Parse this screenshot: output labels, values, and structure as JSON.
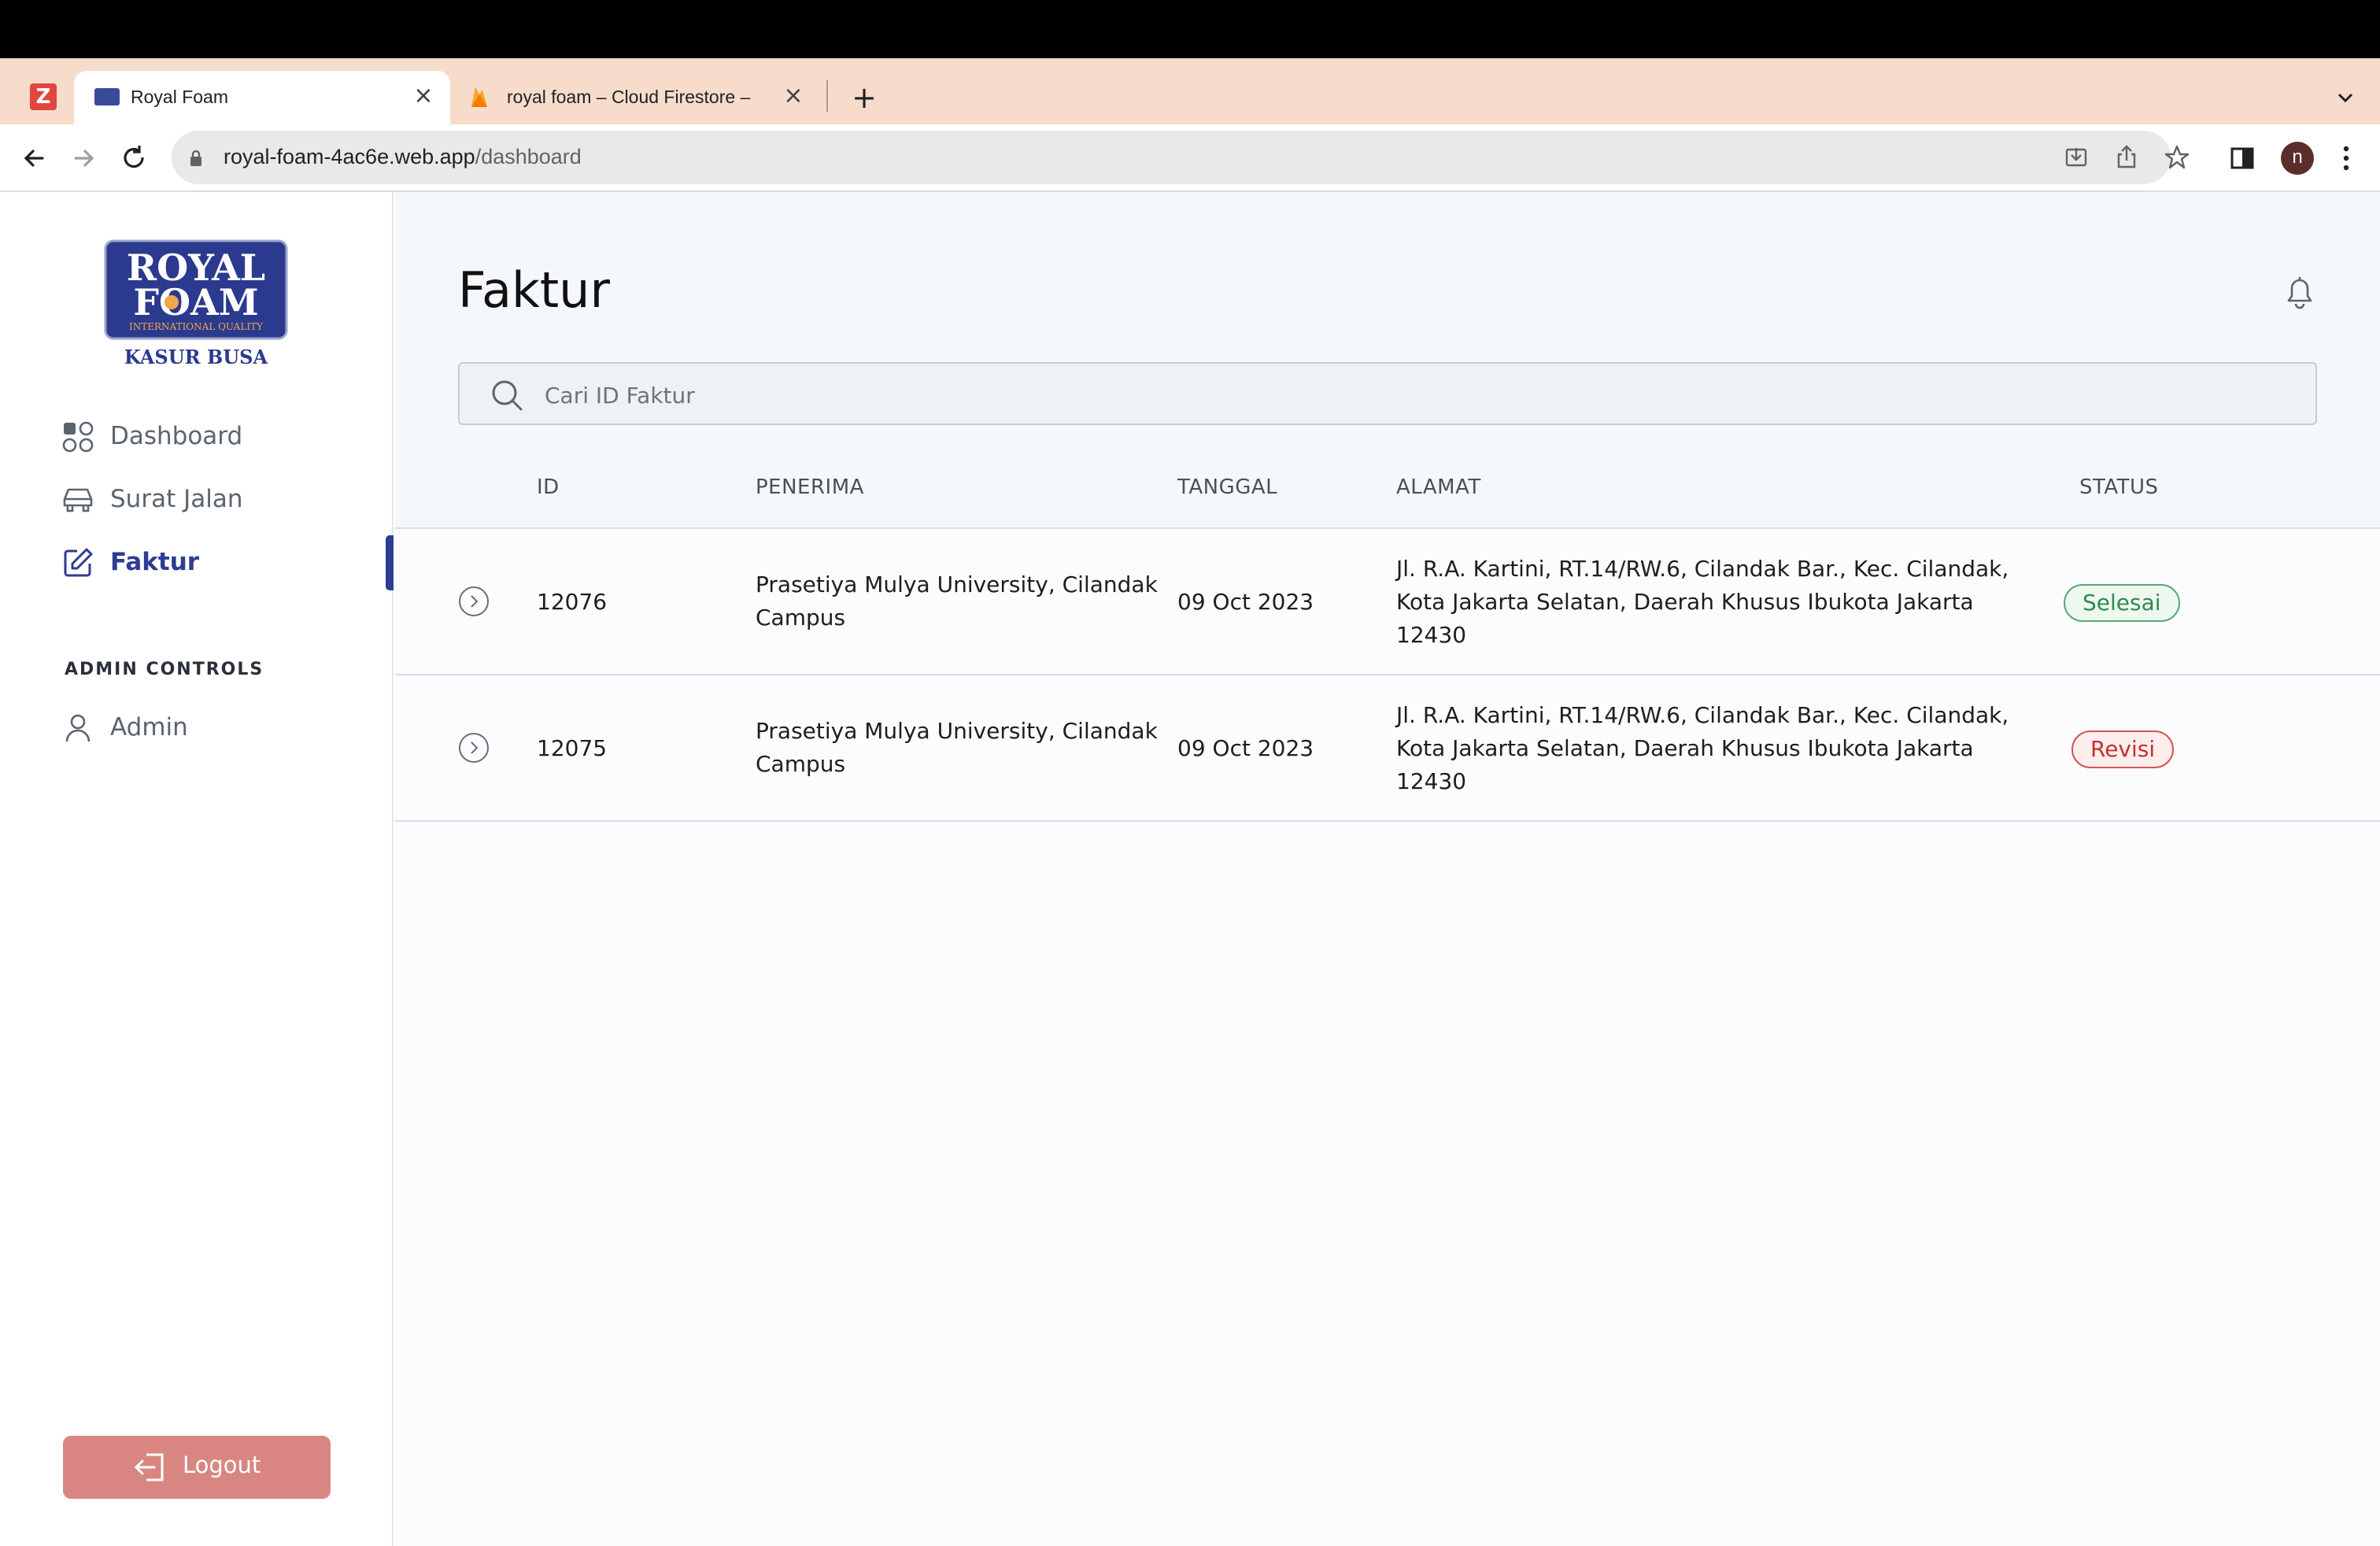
{
  "browser": {
    "tabs": [
      {
        "title": "Royal Foam"
      },
      {
        "title": "royal foam – Cloud Firestore –"
      }
    ],
    "url_host": "royal-foam-4ac6e.web.app",
    "url_path": "/dashboard",
    "profile_initial": "n"
  },
  "sidebar": {
    "logo": {
      "line1": "ROYAL",
      "line2": "FOAM",
      "tagline": "INTERNATIONAL QUALITY",
      "subtitle": "KASUR BUSA"
    },
    "nav": [
      {
        "label": "Dashboard",
        "icon": "grid-icon"
      },
      {
        "label": "Surat Jalan",
        "icon": "car-icon"
      },
      {
        "label": "Faktur",
        "icon": "edit-icon",
        "active": true
      }
    ],
    "admin_section": "ADMIN CONTROLS",
    "admin_item": "Admin",
    "logout_label": "Logout"
  },
  "page": {
    "title": "Faktur",
    "search_placeholder": "Cari ID Faktur"
  },
  "table": {
    "headers": {
      "id": "ID",
      "penerima": "PENERIMA",
      "tanggal": "TANGGAL",
      "alamat": "ALAMAT",
      "status": "STATUS"
    },
    "rows": [
      {
        "id": "12076",
        "penerima_1": "Prasetiya Mulya University, Cilandak",
        "penerima_2": "Campus",
        "tanggal": "09 Oct 2023",
        "alamat_1": "Jl. R.A. Kartini, RT.14/RW.6, Cilandak Bar., Kec. Cilandak,",
        "alamat_2": "Kota Jakarta Selatan, Daerah Khusus Ibukota Jakarta",
        "alamat_3": "12430",
        "status": "Selesai"
      },
      {
        "id": "12075",
        "penerima_1": "Prasetiya Mulya University, Cilandak",
        "penerima_2": "Campus",
        "tanggal": "09 Oct 2023",
        "alamat_1": "Jl. R.A. Kartini, RT.14/RW.6, Cilandak Bar., Kec. Cilandak,",
        "alamat_2": "Kota Jakarta Selatan, Daerah Khusus Ibukota Jakarta",
        "alamat_3": "12430",
        "status": "Revisi"
      }
    ]
  },
  "colors": {
    "brand": "#2d3c94",
    "logout": "#d98682",
    "status_ok": "#2e8a4e",
    "status_revisi": "#c2302c"
  }
}
